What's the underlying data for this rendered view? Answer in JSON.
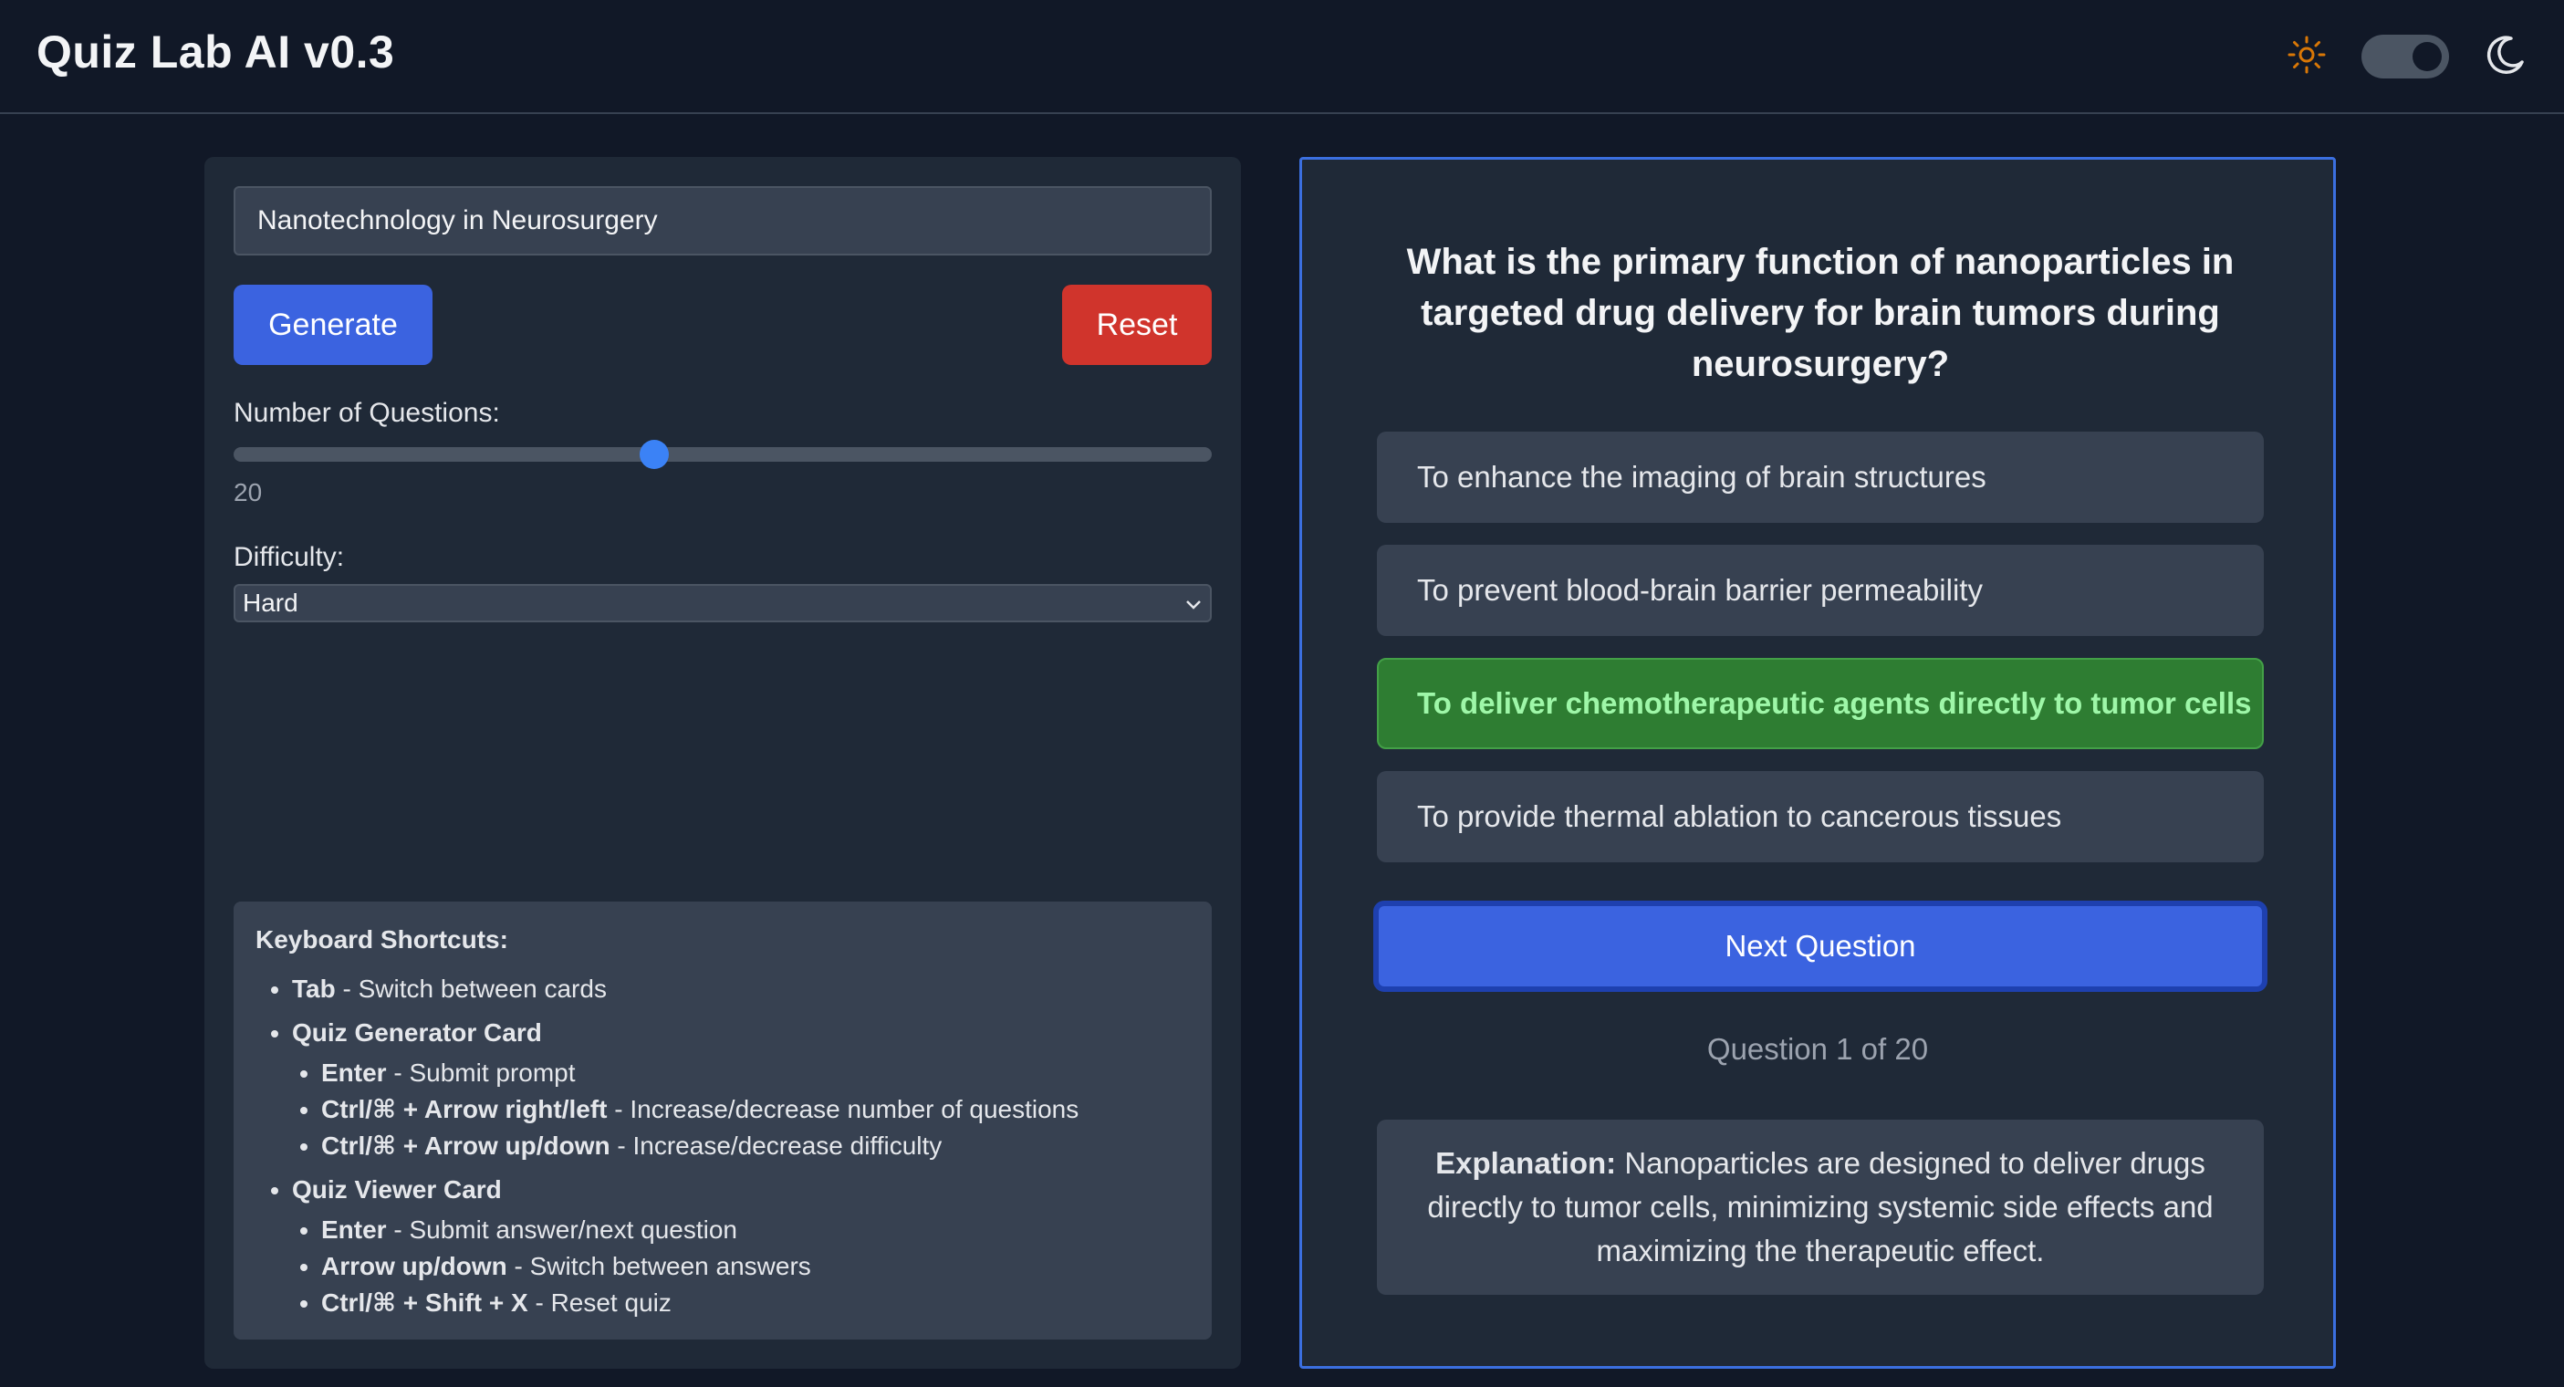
{
  "header": {
    "title": "Quiz Lab AI v0.3",
    "sun_icon": "sun-icon",
    "moon_icon": "moon-icon",
    "dark_mode": true
  },
  "generator": {
    "topic_value": "Nanotechnology in Neurosurgery",
    "generate_label": "Generate",
    "reset_label": "Reset",
    "num_questions_label": "Number of Questions:",
    "num_questions_value": "20",
    "num_questions_fraction": 0.43,
    "difficulty_label": "Difficulty:",
    "difficulty_value": "Hard"
  },
  "shortcuts": {
    "title": "Keyboard Shortcuts:",
    "tab_key": "Tab",
    "tab_desc": " - Switch between cards",
    "generator_group": "Quiz Generator Card",
    "gen_items": [
      {
        "key": "Enter",
        "desc": " - Submit prompt"
      },
      {
        "key": "Ctrl/⌘ + Arrow right/left",
        "desc": " - Increase/decrease number of questions"
      },
      {
        "key": "Ctrl/⌘ + Arrow up/down",
        "desc": " - Increase/decrease difficulty"
      }
    ],
    "viewer_group": "Quiz Viewer Card",
    "view_items": [
      {
        "key": "Enter",
        "desc": " - Submit answer/next question"
      },
      {
        "key": "Arrow up/down",
        "desc": " - Switch between answers"
      },
      {
        "key": "Ctrl/⌘ + Shift + X",
        "desc": " - Reset quiz"
      }
    ]
  },
  "viewer": {
    "question": "What is the primary function of nanoparticles in targeted drug delivery for brain tumors during neurosurgery?",
    "answers": [
      "To enhance the imaging of brain structures",
      "To prevent blood-brain barrier permeability",
      "To deliver chemotherapeutic agents directly to tumor cells",
      "To provide thermal ablation to cancerous tissues"
    ],
    "next_label": "Next Question",
    "progress": "Question 1 of 20",
    "explanation_label": "Explanation:",
    "explanation_text": " Nanoparticles are designed to deliver drugs directly to tumor cells, minimizing systemic side effects and maximizing the therapeutic effect."
  },
  "colors": {
    "accent": "#3b63e0",
    "reset": "#d0342c",
    "correct": "#2e7d32"
  }
}
